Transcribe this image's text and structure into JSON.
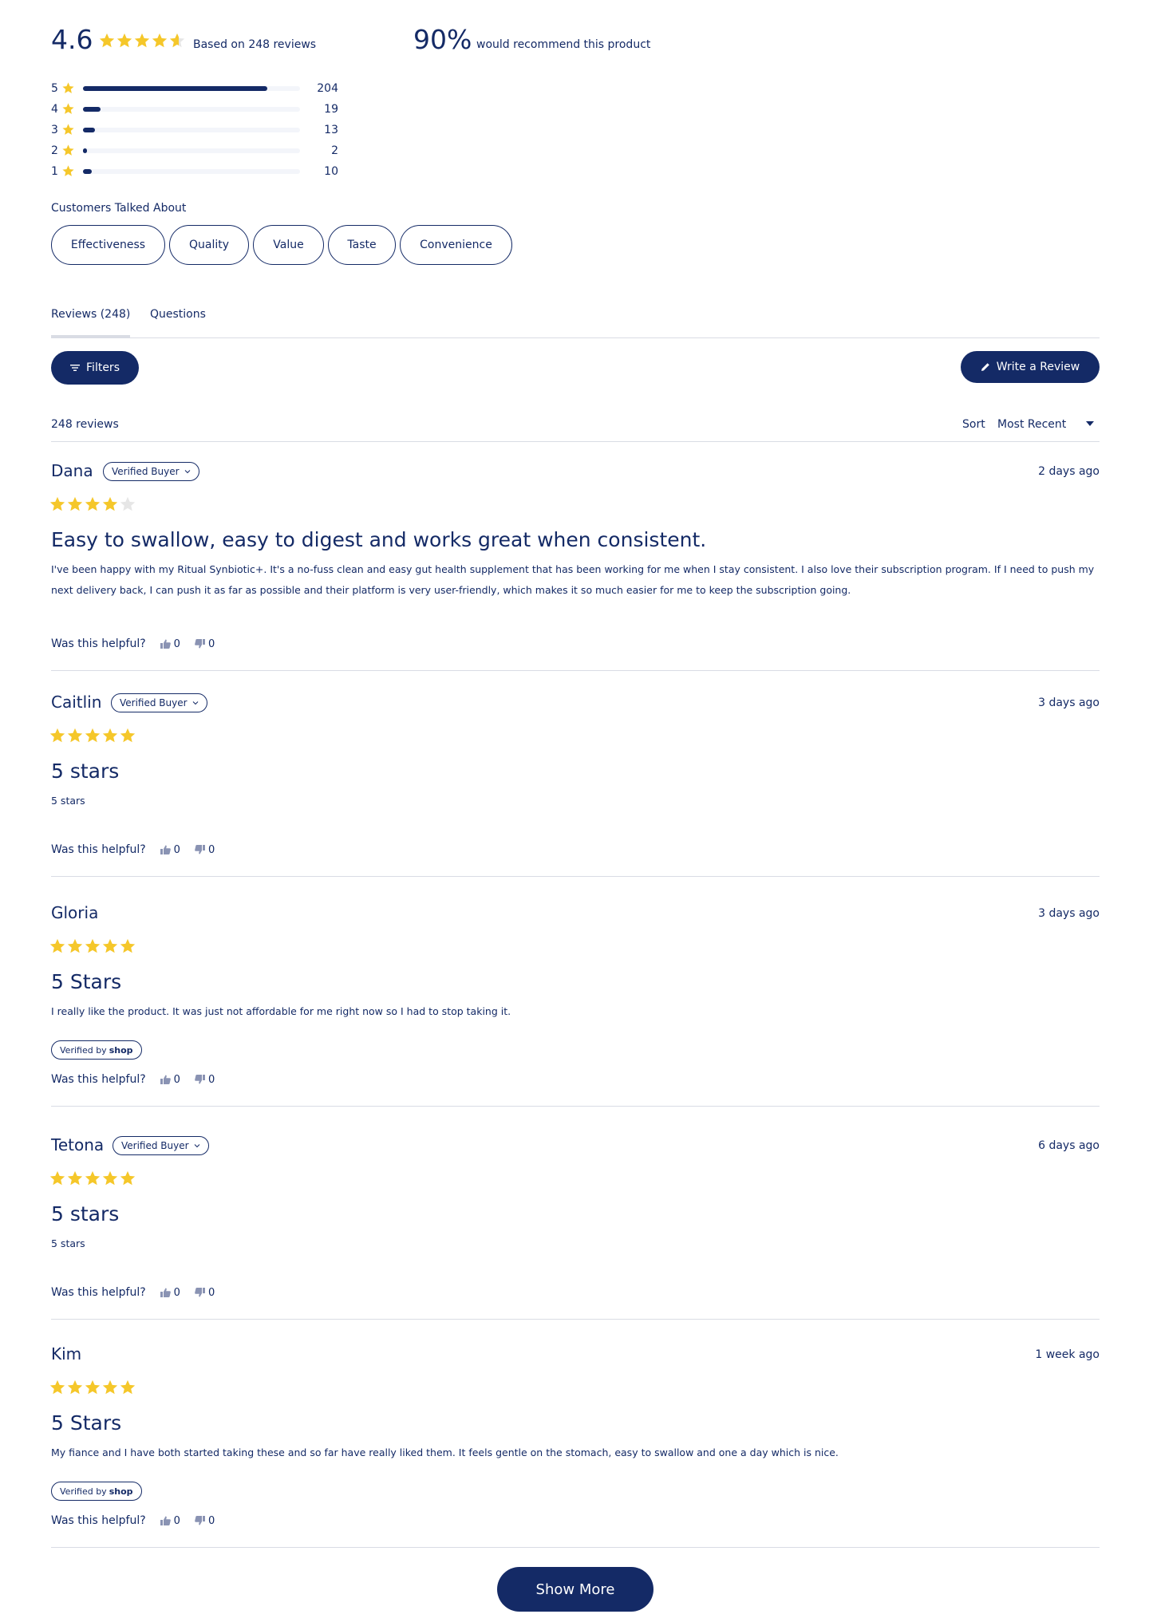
{
  "colors": {
    "primary": "#142a66",
    "star": "#f5c72a",
    "star_empty": "#e6e6e6",
    "divider": "#d9dce4",
    "track": "#f3f5fa"
  },
  "summary": {
    "average": "4.6",
    "average_rating": 4.6,
    "based_on": "Based on 248 reviews",
    "recommend_pct": "90%",
    "recommend_text": "would recommend this product"
  },
  "distribution": [
    {
      "stars": "5",
      "count": "204",
      "fraction": 0.85
    },
    {
      "stars": "4",
      "count": "19",
      "fraction": 0.08
    },
    {
      "stars": "3",
      "count": "13",
      "fraction": 0.055
    },
    {
      "stars": "2",
      "count": "2",
      "fraction": 0.02
    },
    {
      "stars": "1",
      "count": "10",
      "fraction": 0.04
    }
  ],
  "topics": {
    "heading": "Customers Talked About",
    "chips": [
      "Effectiveness",
      "Quality",
      "Value",
      "Taste",
      "Convenience"
    ]
  },
  "tabs": {
    "reviews": "Reviews (248)",
    "questions": "Questions"
  },
  "toolbar": {
    "filters": "Filters",
    "write_review": "Write a Review"
  },
  "list_header": {
    "count": "248 reviews",
    "sort_label": "Sort",
    "sort_value": "Most Recent"
  },
  "helpful_label": "Was this helpful?",
  "reviews": [
    {
      "name": "Dana",
      "verified_buyer": "Verified Buyer",
      "date": "2 days ago",
      "rating": 4,
      "title": "Easy to swallow, easy to digest and works great when consistent.",
      "body": "I've been happy with my Ritual Synbiotic+. It's a no-fuss clean and easy gut health supplement that has been working for me when I stay consistent. I also love their subscription program. If I need to push my next delivery back, I can push it as far as possible and their platform is very user-friendly, which makes it so much easier for me to keep the subscription going.",
      "up": "0",
      "down": "0"
    },
    {
      "name": "Caitlin",
      "verified_buyer": "Verified Buyer",
      "date": "3 days ago",
      "rating": 5,
      "title": "5 stars",
      "body": "5 stars",
      "up": "0",
      "down": "0"
    },
    {
      "name": "Gloria",
      "date": "3 days ago",
      "rating": 5,
      "title": "5 Stars",
      "body": "I really like the product. It was just not affordable for me right now so I had to stop taking it.",
      "verified_by": "Verified by",
      "shop": "shop",
      "up": "0",
      "down": "0"
    },
    {
      "name": "Tetona",
      "verified_buyer": "Verified Buyer",
      "date": "6 days ago",
      "rating": 5,
      "title": "5 stars",
      "body": "5 stars",
      "up": "0",
      "down": "0"
    },
    {
      "name": "Kim",
      "date": "1 week ago",
      "rating": 5,
      "title": "5 Stars",
      "body": "My fiance and I have both started taking these and so far have really liked them. It feels gentle on the stomach, easy to swallow and one a day which is nice.",
      "verified_by": "Verified by",
      "shop": "shop",
      "up": "0",
      "down": "0"
    }
  ],
  "show_more": "Show More"
}
